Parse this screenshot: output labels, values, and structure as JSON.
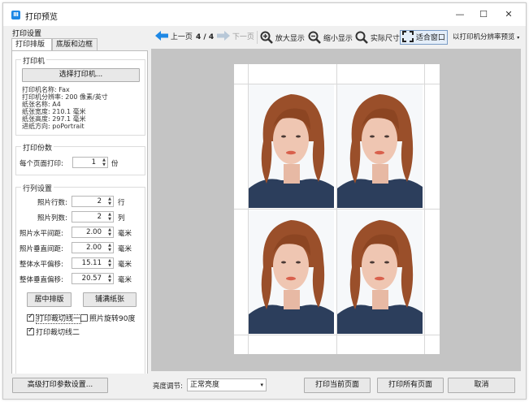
{
  "window": {
    "title": "打印预览",
    "app_icon": "Ⅲ",
    "controls": {
      "minimize": "—",
      "maximize": "☐",
      "close": "✕"
    }
  },
  "left_panel": {
    "caption": "打印设置",
    "tabs": [
      {
        "label": "打印排版",
        "active": true
      },
      {
        "label": "底版和边框",
        "active": false
      }
    ],
    "printer_group": {
      "title": "打印机",
      "select_button": "选择打印机...",
      "info": [
        "打印机名称: Fax",
        "打印机分辨率: 200 像素/英寸",
        "纸张名称: A4",
        "纸张宽度: 210.1 毫米",
        "纸张高度: 297.1 毫米",
        "进纸方向: poPortrait"
      ]
    },
    "copies_group": {
      "title": "打印份数",
      "label": "每个页面打印:",
      "value": "1",
      "unit": "份"
    },
    "layout_group": {
      "title": "行列设置",
      "rows": [
        {
          "label": "照片行数:",
          "value": "2",
          "unit": "行"
        },
        {
          "label": "照片列数:",
          "value": "2",
          "unit": "列"
        },
        {
          "label": "照片水平间距:",
          "value": "2.00",
          "unit": "毫米"
        },
        {
          "label": "照片垂直间距:",
          "value": "2.00",
          "unit": "毫米"
        },
        {
          "label": "整体水平偏移:",
          "value": "15.11",
          "unit": "毫米"
        },
        {
          "label": "整体垂直偏移:",
          "value": "20.57",
          "unit": "毫米"
        }
      ],
      "center_button": "居中排版",
      "fill_button": "铺满纸张",
      "checkboxes": [
        {
          "label": "打印裁切线一",
          "checked": true
        },
        {
          "label": "照片旋转90度",
          "checked": false
        },
        {
          "label": "打印裁切线二",
          "checked": true
        }
      ]
    }
  },
  "toolbar": {
    "prev": "上一页",
    "page_indicator": "4 / 4",
    "next": "下一页",
    "zoom_in": "放大显示",
    "zoom_out": "缩小显示",
    "actual_size": "实际尺寸",
    "fit_window": "适合窗口",
    "printer_resolution_preview": "以打印机分辨率预览",
    "icon_names": [
      "arrow-left-icon",
      "arrow-right-icon",
      "zoom-in-icon",
      "zoom-out-icon",
      "actual-size-icon",
      "fit-window-icon"
    ],
    "accent_color": "#1e88e5"
  },
  "preview": {
    "photo_count": 4,
    "rows": 2,
    "cols": 2,
    "background_color": "#c4c4c4"
  },
  "bottom_bar": {
    "advanced_button": "高级打印参数设置...",
    "brightness_label": "亮度调节:",
    "brightness_value": "正常亮度",
    "print_current": "打印当前页面",
    "print_all": "打印所有页面",
    "cancel": "取消"
  }
}
